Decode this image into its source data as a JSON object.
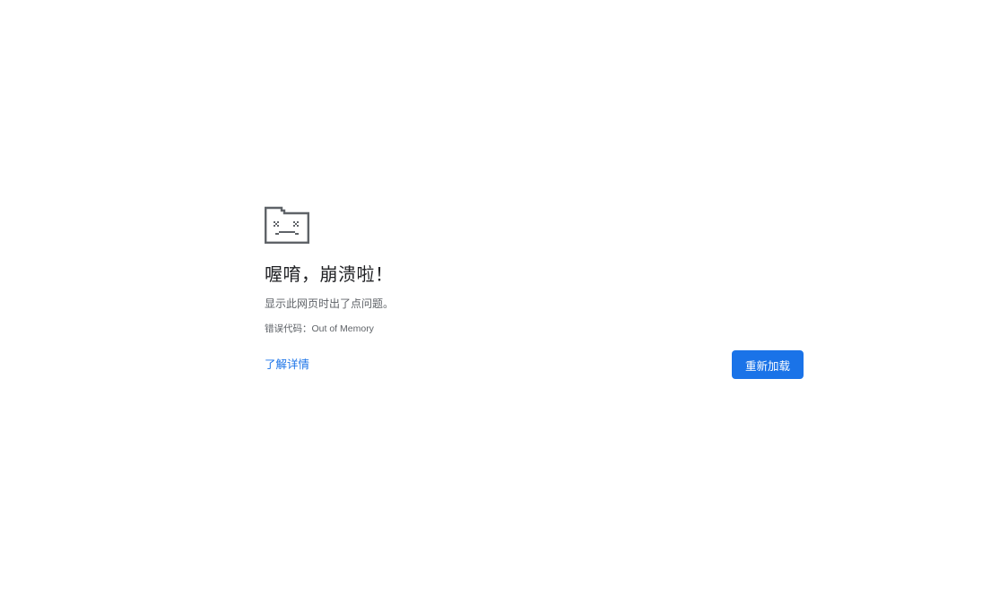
{
  "crash": {
    "icon": "sad-tab-icon",
    "heading": "喔唷，崩溃啦！",
    "message": "显示此网页时出了点问题。",
    "error_code": "错误代码：Out of Memory",
    "learn_more_label": "了解详情",
    "reload_label": "重新加载"
  },
  "colors": {
    "accent": "#1a73e8",
    "icon": "#5f6368",
    "heading": "#202124",
    "text": "#5f6368"
  }
}
